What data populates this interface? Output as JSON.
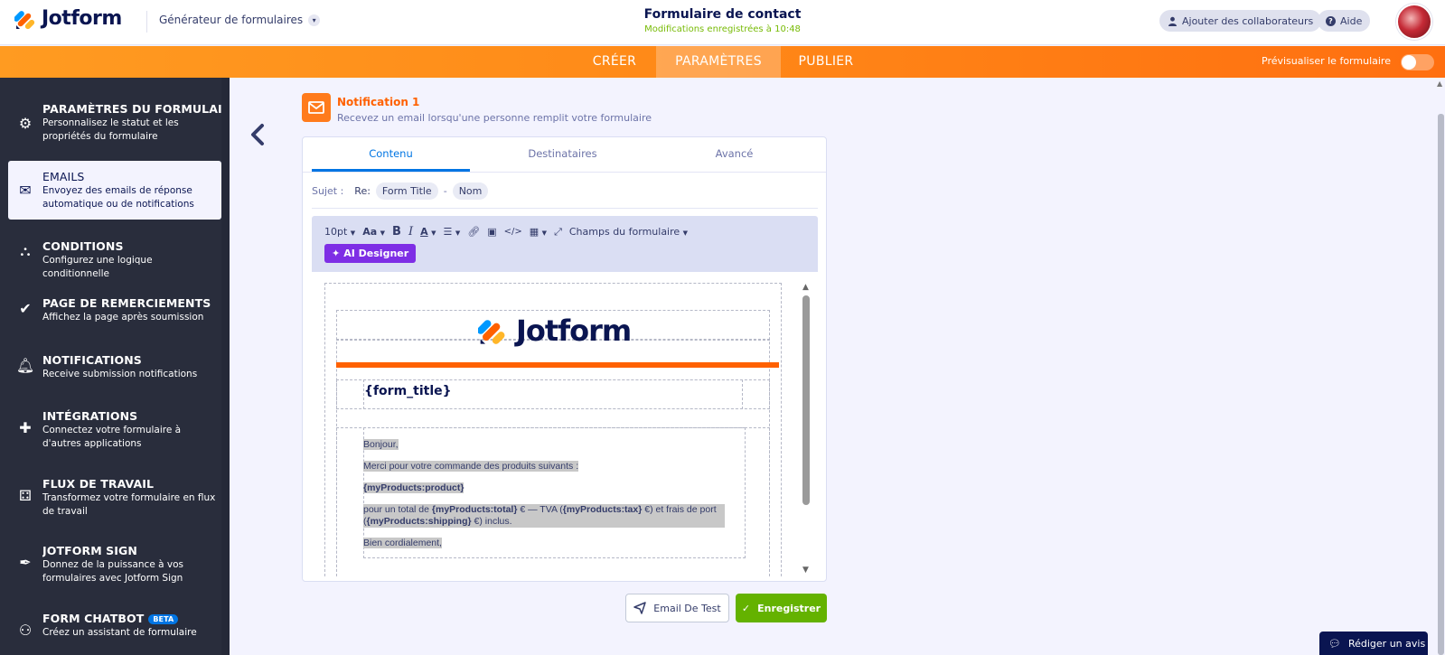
{
  "header": {
    "brand": "Jotform",
    "builder_menu": "Générateur de formulaires",
    "form_title": "Formulaire de contact",
    "save_status": "Modifications enregistrées à 10:48",
    "add_collaborators": "Ajouter des collaborateurs",
    "help": "Aide"
  },
  "nav": {
    "tabs": [
      "CRÉER",
      "PARAMÈTRES",
      "PUBLIER"
    ],
    "active_tab": "PARAMÈTRES",
    "preview_label": "Prévisualiser le formulaire",
    "preview_enabled": false
  },
  "sidebar": {
    "items": [
      {
        "title": "PARAMÈTRES DU FORMULAI...",
        "desc": "Personnalisez le statut et les propriétés du formulaire",
        "icon": "gear-icon"
      },
      {
        "title": "EMAILS",
        "desc": "Envoyez des emails de réponse automatique ou de notifications",
        "icon": "envelope-icon",
        "active": true
      },
      {
        "title": "CONDITIONS",
        "desc": "Configurez une logique conditionnelle",
        "icon": "conditions-icon"
      },
      {
        "title": "PAGE DE REMERCIEMENTS",
        "desc": "Affichez la page après soumission",
        "icon": "check-circle-icon"
      },
      {
        "title": "NOTIFICATIONS",
        "desc": "Receive submission notifications",
        "icon": "bell-icon"
      },
      {
        "title": "INTÉGRATIONS",
        "desc": "Connectez votre formulaire à d'autres applications",
        "icon": "puzzle-icon"
      },
      {
        "title": "FLUX DE TRAVAIL",
        "desc": "Transformez votre formulaire en flux de travail",
        "icon": "workflow-icon"
      },
      {
        "title": "JOTFORM SIGN",
        "desc": "Donnez de la puissance à vos formulaires avec Jotform Sign",
        "icon": "pen-icon"
      },
      {
        "title": "FORM CHATBOT",
        "badge": "BETA",
        "desc": "Créez un assistant de formulaire",
        "icon": "chatbot-icon"
      }
    ]
  },
  "notification": {
    "title": "Notification 1",
    "subtitle": "Recevez un email lorsqu'une personne remplit votre formulaire"
  },
  "editor_tabs": [
    "Contenu",
    "Destinataires",
    "Avancé"
  ],
  "subject": {
    "label": "Sujet :",
    "prefix": "Re:",
    "tags": [
      "Form Title",
      "Nom"
    ],
    "separator": "-"
  },
  "toolbar": {
    "font_size": "10pt",
    "font_family": "Aa",
    "bold": "B",
    "italic": "I",
    "text_color": "A",
    "fields_menu": "Champs du formulaire",
    "ai_designer": "AI Designer"
  },
  "email_preview": {
    "logo_text": "Jotform",
    "form_title_placeholder": "{form_title}",
    "greeting": "Bonjour,",
    "thanks": "Merci pour votre commande des produits suivants :",
    "products": "{myProducts:product}",
    "total_1": "pour un total de ",
    "total_var": "{myProducts:total}",
    "total_2": " € — TVA (",
    "tax_var": "{myProducts:tax}",
    "total_3": " €) et frais de port (",
    "shipping_var": "{myProducts:shipping}",
    "total_4": " €) inclus.",
    "closing": "Bien cordialement,"
  },
  "buttons": {
    "test_email": "Email De Test",
    "save": "Enregistrer"
  },
  "review_button": "Rédiger un avis",
  "colors": {
    "accent_orange": "#ff6100",
    "brand_navy": "#0a1551",
    "link_blue": "#0075e3",
    "save_green": "#64b200",
    "ai_purple": "#7e2ee5",
    "sidebar_bg": "#292d3c"
  }
}
